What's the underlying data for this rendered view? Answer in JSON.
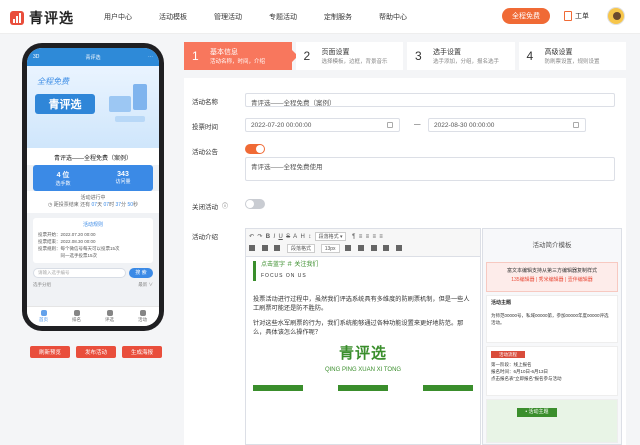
{
  "header": {
    "logo_text": "青评选",
    "nav": [
      "用户中心",
      "活动模板",
      "管理活动",
      "专题活动",
      "定制服务",
      "帮助中心"
    ],
    "free_button": "全程免费",
    "order_label": "工单",
    "colors": {
      "accent": "#f06a35",
      "brand": "#e94e3c"
    }
  },
  "phone": {
    "top_bar": {
      "left": "3D",
      "title": "青评选",
      "right": "⋯"
    },
    "banner": {
      "free_text": "全程免费",
      "brand": "青评选"
    },
    "title": "青评选——全程免费（案例）",
    "stats": [
      {
        "value": "4 位",
        "label": "选手数"
      },
      {
        "value": "343",
        "label": "访问量"
      }
    ],
    "progress": {
      "status": "活动进行中",
      "prefix": "距投票结束 还有",
      "days": "07",
      "days_unit": "天",
      "hours": "07",
      "hours_unit": "时",
      "minutes": "37",
      "minutes_unit": "分",
      "seconds": "50",
      "seconds_unit": "秒"
    },
    "rules": {
      "title": "活动规则",
      "lines": [
        "投票开始：2022.07.20 00:00",
        "投票结束：2022.08.30 00:00",
        "投票规则：每个微信号每天可以投票15次",
        "　　　　　同一选手投票15次"
      ]
    },
    "search": {
      "placeholder": "请输入选手编号",
      "button": "搜 索"
    },
    "select": {
      "label": "选手分组",
      "value": "最新 ∨"
    },
    "tabs": [
      "首页",
      "排名",
      "评选",
      "活动"
    ],
    "buttons": [
      "刷新预览",
      "发布活动",
      "生成海报"
    ]
  },
  "steps": [
    {
      "num": "1",
      "title": "基本信息",
      "sub": "活动名称，时间，介绍"
    },
    {
      "num": "2",
      "title": "页面设置",
      "sub": "选择模板，边框，背景音乐"
    },
    {
      "num": "3",
      "title": "选手设置",
      "sub": "选手添加，分组，报名选手"
    },
    {
      "num": "4",
      "title": "高级设置",
      "sub": "防刷票设置，规则设置"
    }
  ],
  "form": {
    "name_label": "活动名称",
    "name_value": "青评选——全程免费（案例）",
    "time_label": "投票时间",
    "start": "2022-07-20 00:00:00",
    "sep": "—",
    "end": "2022-08-30 00:00:00",
    "notice_label": "活动公告",
    "notice_on": true,
    "notice_value": "青评选——全程免费使用",
    "close_label": "关闭活动",
    "close_on": false,
    "intro_label": "活动介绍"
  },
  "editor": {
    "toolbar_row1": [
      "↶",
      "↷",
      "B",
      "I",
      "U",
      "S",
      "A",
      "H",
      "↕",
      "段落格式 ▾",
      "¶",
      "≡",
      "≡",
      "≡",
      "≡"
    ],
    "toolbar_row2": [
      "段落格式",
      "13px"
    ],
    "follow_line": "点击蓝字 ＃ 关注我们",
    "follow_sub": "FOCUS ON US",
    "para1": "投票活动进行过程中，虽然我们评选系统具有多维度的防刷票机制，但是一些人工刷票可能还是防不胜防。",
    "para2": "针对这些水军刷票的行为，我们系统能够通过各种功能设置来更好地防范。那么，具体该怎么操作呢？",
    "green_title": "青评选",
    "pinyin": "QING PING XUAN XI TONG",
    "green_color": "#3a8e2c"
  },
  "templates": {
    "title": "活动简介模板",
    "card1": {
      "line1": "富文本编辑支持从第三方编辑器复制样式",
      "line2": "135编辑器 | 秀米编辑器 | 壹伴编辑器"
    },
    "card2": {
      "title": "活动主题",
      "text": "为师范00000号，私域00000第，参加00000年度00000评选活动。"
    },
    "card3": {
      "title": "活动流程",
      "lines": [
        "第一阶段：线上报名",
        "报名时间：6月10日-6月13日",
        "点击报名表“立即报名”报名参与活动"
      ]
    },
    "card4": {
      "label": "• 活动主题"
    }
  }
}
